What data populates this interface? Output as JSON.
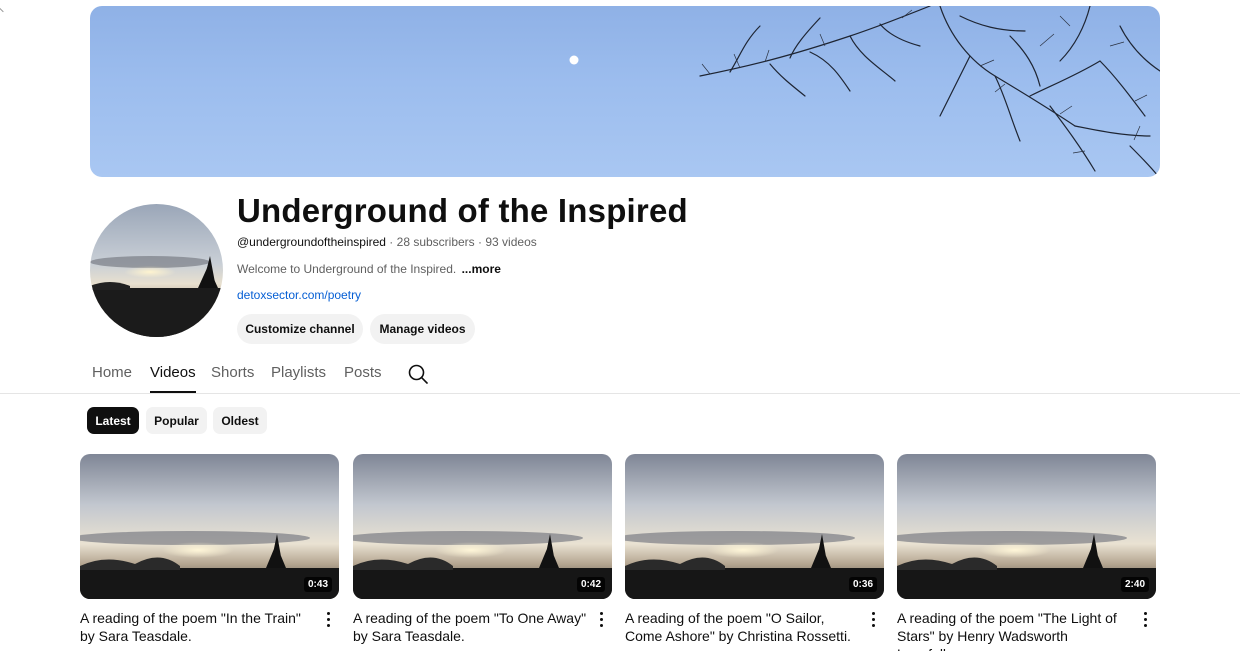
{
  "channel": {
    "title": "Underground of the Inspired",
    "handle": "@undergroundoftheinspired",
    "subscribers": "28 subscribers",
    "video_count": "93 videos",
    "description": "Welcome to Underground of the Inspired.",
    "more_label": "...more",
    "link": "detoxsector.com/poetry",
    "customize_label": "Customize channel",
    "manage_label": "Manage videos"
  },
  "tabs": [
    {
      "label": "Home"
    },
    {
      "label": "Videos"
    },
    {
      "label": "Shorts"
    },
    {
      "label": "Playlists"
    },
    {
      "label": "Posts"
    }
  ],
  "filters": [
    {
      "label": "Latest"
    },
    {
      "label": "Popular"
    },
    {
      "label": "Oldest"
    }
  ],
  "videos": [
    {
      "title": "A reading of the poem \"In the Train\" by Sara Teasdale.",
      "duration": "0:43"
    },
    {
      "title": "A reading of the poem \"To One Away\" by Sara Teasdale.",
      "duration": "0:42"
    },
    {
      "title": "A reading of the poem \"O Sailor, Come Ashore\" by Christina Rossetti.",
      "duration": "0:36"
    },
    {
      "title": "A reading of the poem \"The Light of Stars\" by Henry Wadsworth Longfellow.",
      "duration": "2:40"
    }
  ],
  "colors": {
    "accent_link": "#065fd4",
    "chip_active": "#0f0f0f",
    "chip_bg": "#f2f2f2"
  },
  "icons": {
    "search": "search-icon",
    "more": "more-vertical-icon"
  }
}
